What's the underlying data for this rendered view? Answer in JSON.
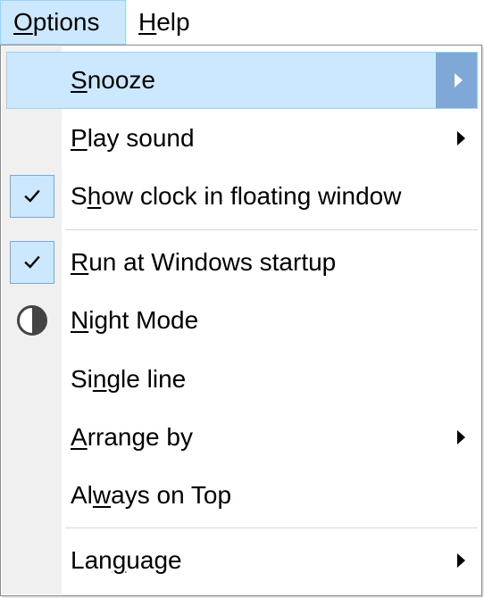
{
  "menubar": {
    "items": [
      {
        "label_pre": "",
        "label_key": "O",
        "label_post": "ptions"
      },
      {
        "label_pre": "",
        "label_key": "H",
        "label_post": "elp"
      }
    ]
  },
  "menu": {
    "items": [
      {
        "pre": "",
        "key": "S",
        "post": "nooze",
        "has_submenu": true,
        "highlighted": true
      },
      {
        "pre": "",
        "key": "P",
        "post": "lay sound",
        "has_submenu": true
      },
      {
        "pre": "S",
        "key": "h",
        "post": "ow clock in floating window",
        "checked": true
      },
      {
        "pre": "",
        "key": "R",
        "post": "un at Windows startup",
        "checked": true
      },
      {
        "pre": "",
        "key": "N",
        "post": "ight Mode",
        "icon": "half-circle-contrast-icon"
      },
      {
        "pre": "Si",
        "key": "n",
        "post": "gle line"
      },
      {
        "pre": "",
        "key": "A",
        "post": "rrange by",
        "has_submenu": true
      },
      {
        "pre": "Al",
        "key": "w",
        "post": "ays on Top"
      },
      {
        "pre": "Lan",
        "key": "g",
        "post": "uage",
        "has_submenu": true
      }
    ]
  },
  "colors": {
    "highlight_bg": "#cce8ff",
    "highlight_border": "#99d1ff",
    "arrow_box": "#7fa8d6",
    "gutter": "#f0f0f0"
  }
}
